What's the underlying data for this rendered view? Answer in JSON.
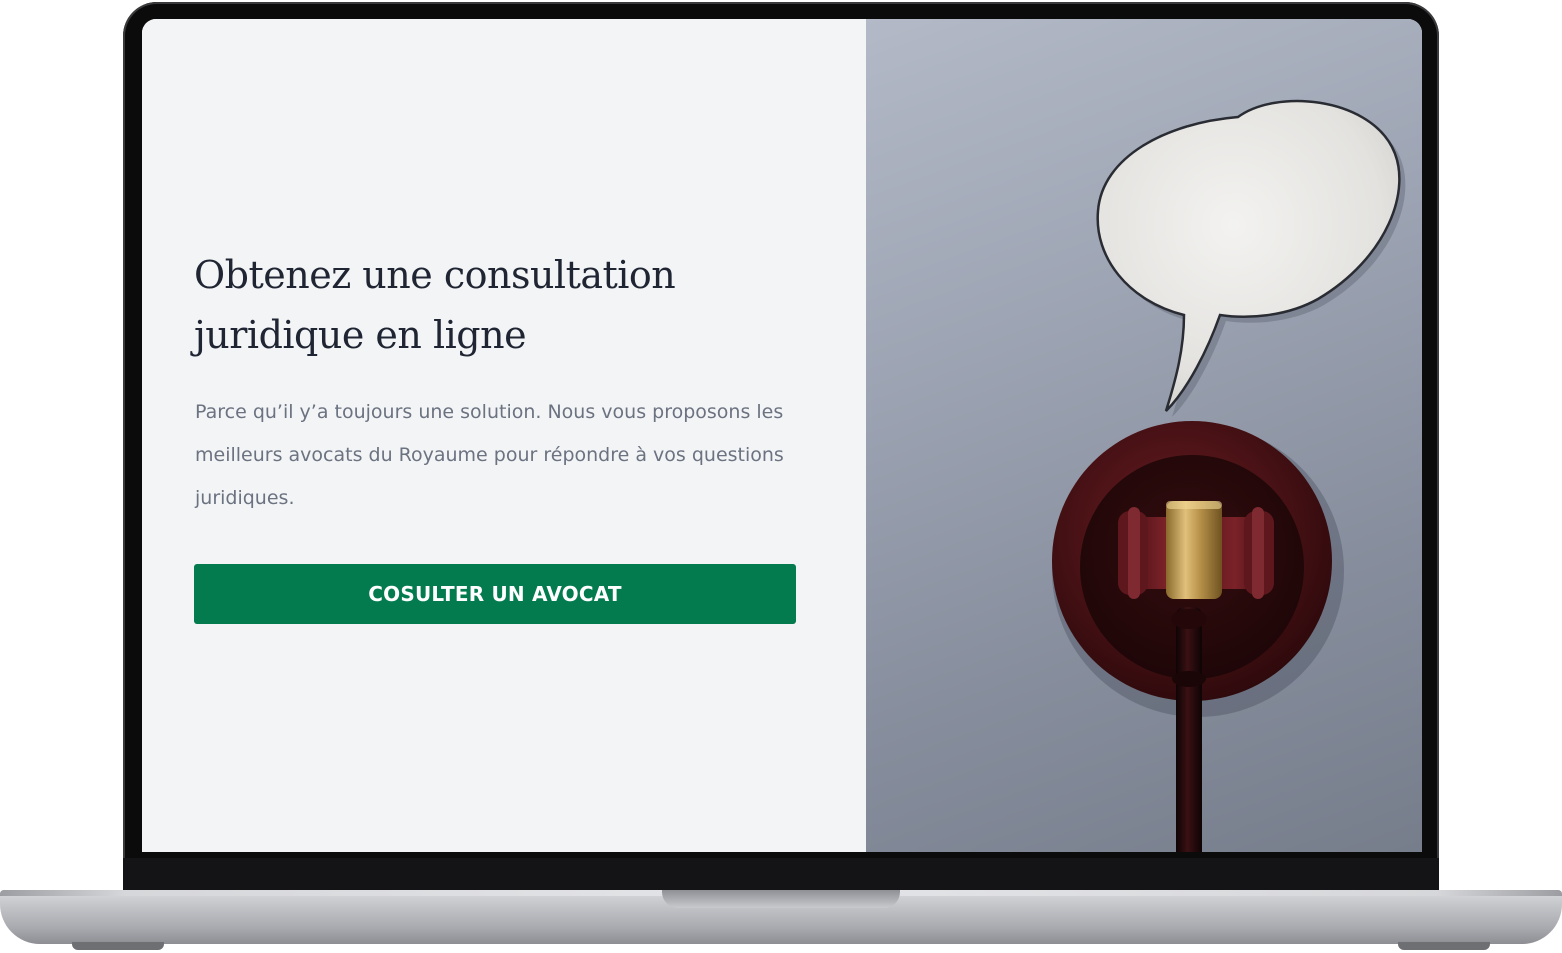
{
  "hero": {
    "headline": "Obtenez une consultation juridique en ligne",
    "description": "Parce qu’il y’a toujours une solution. Nous vous proposons les meilleurs avocats du Royaume pour répondre à vos questions juridiques.",
    "cta_label": "COSULTER UN AVOCAT"
  },
  "colors": {
    "page_background": "#f3f4f6",
    "headline": "#1f2533",
    "body_text": "#6b7280",
    "cta_background": "#037b4f",
    "cta_text": "#ffffff",
    "image_background": "#9da4b3"
  },
  "image": {
    "subject": "speech-bubble-and-judge-gavel"
  }
}
